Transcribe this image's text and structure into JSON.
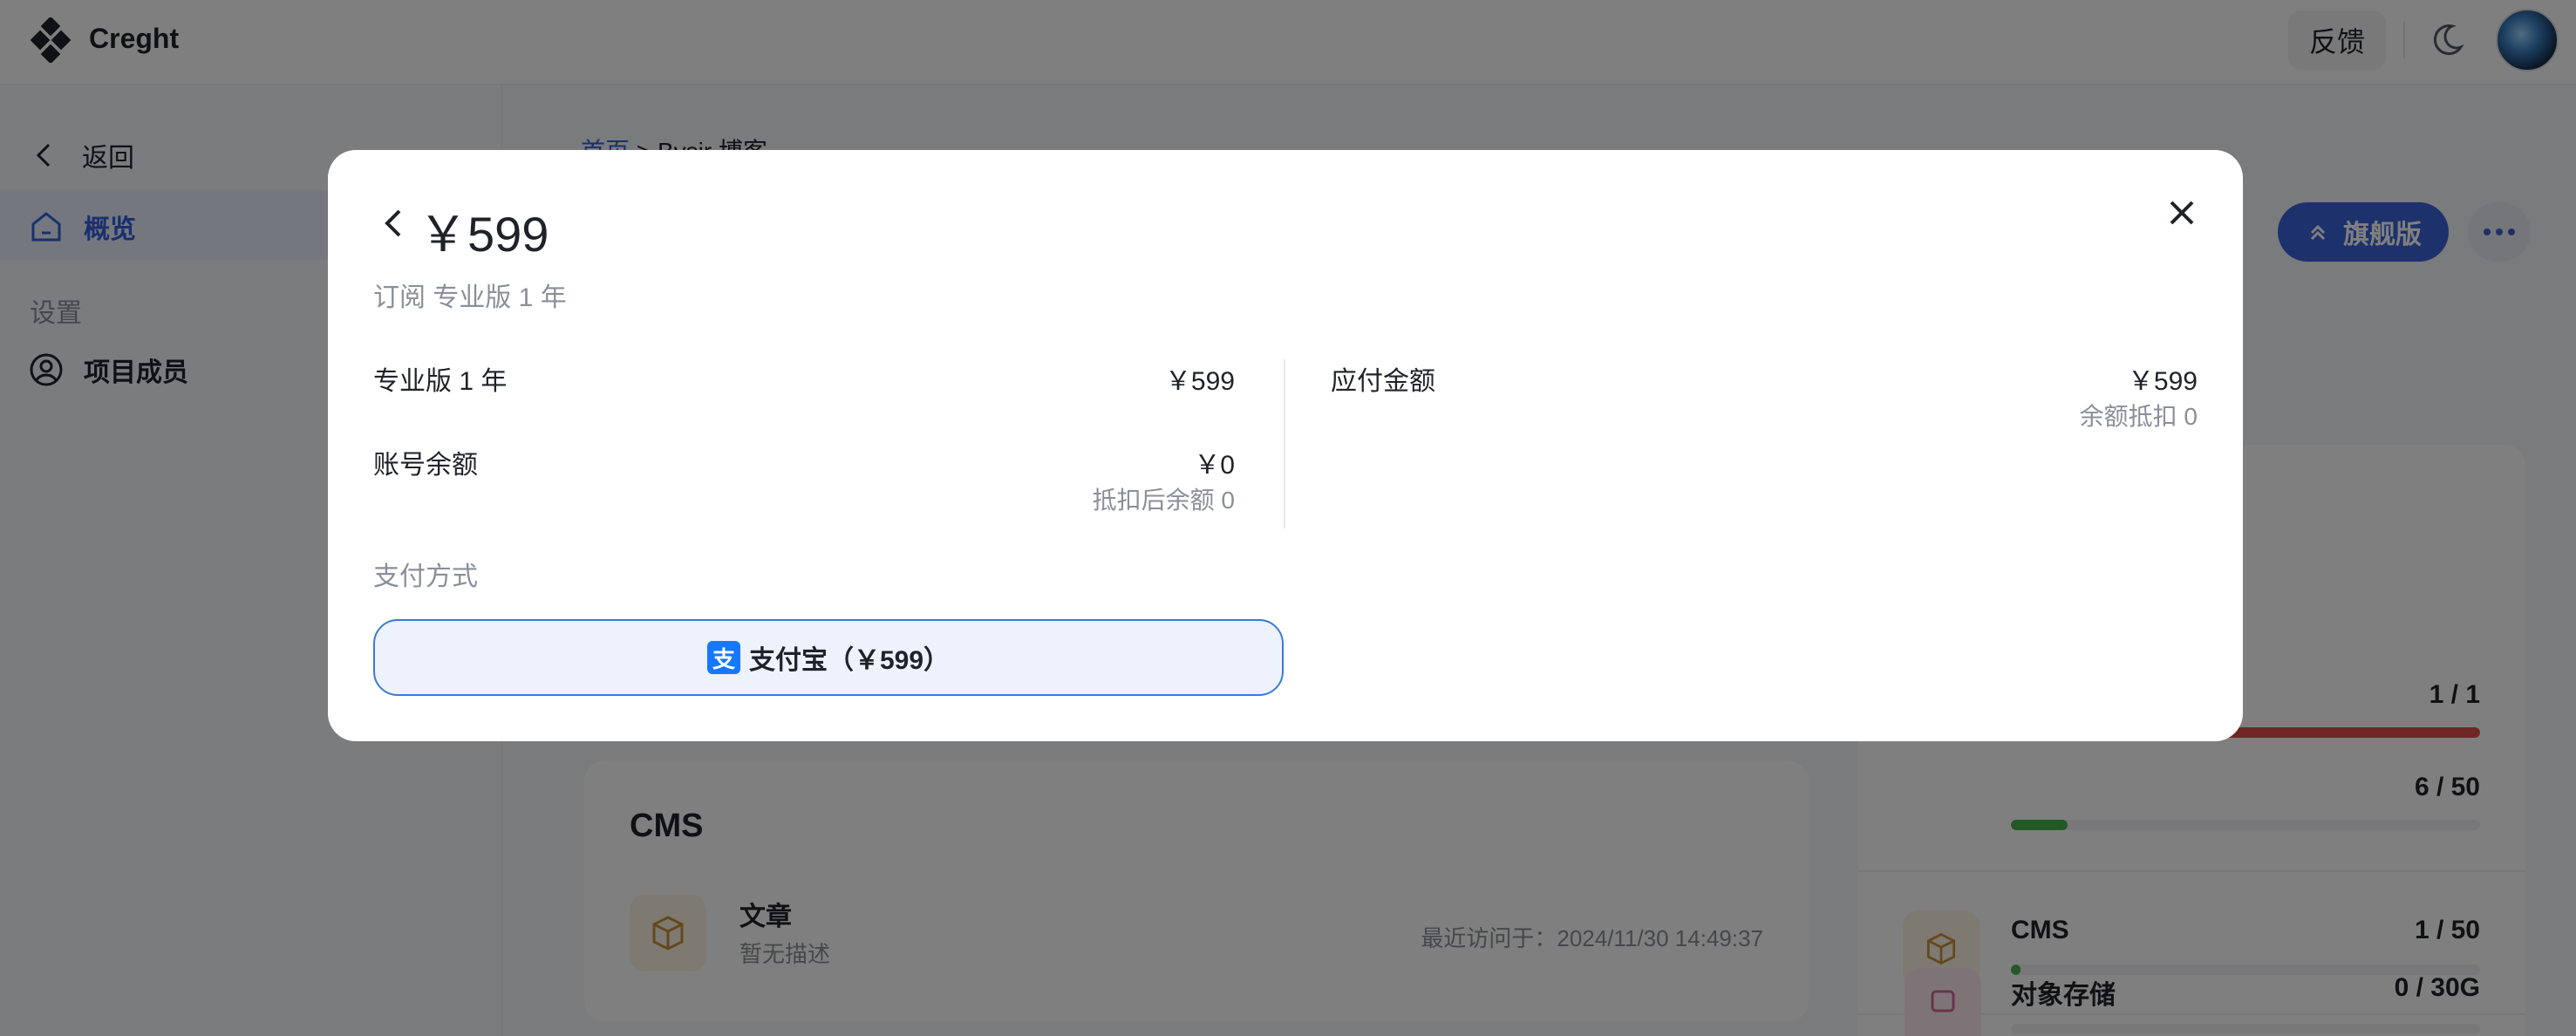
{
  "topbar": {
    "brand": "Creght",
    "feedback_label": "反馈",
    "theme_icon": "moon-icon",
    "avatar_icon": "avatar"
  },
  "sidebar": {
    "back_label": "返回",
    "overview_label": "概览",
    "settings_section": "设置",
    "members_label": "项目成员"
  },
  "main": {
    "breadcrumb_home": "首页",
    "breadcrumb_sep": ">",
    "breadcrumb_current": "Bysir 博客",
    "flagship_label": "旗舰版"
  },
  "cms_card": {
    "title": "CMS",
    "article_title": "文章",
    "article_desc": "暂无描述",
    "last_visit": "最近访问于：2024/11/30 14:49:37"
  },
  "usage": {
    "rows": [
      {
        "name": "",
        "value": "1 / 1",
        "fraction": 1.0,
        "color": "#e04c4c"
      },
      {
        "name": "",
        "value": "6 / 50",
        "fraction": 0.12,
        "color": "#49b14f"
      },
      {
        "name": "CMS",
        "value": "1 / 50",
        "fraction": 0.02,
        "color": "#49b14f"
      },
      {
        "name": "对象存储",
        "value": "0 / 30G",
        "fraction": 0.0,
        "color": "#49b14f"
      }
    ]
  },
  "modal": {
    "price": "￥599",
    "subtitle": "订阅 专业版 1 年",
    "item_label": "专业版 1 年",
    "item_value": "￥599",
    "balance_label": "账号余额",
    "balance_value": "￥0",
    "balance_note": "抵扣后余额 0",
    "due_label": "应付金额",
    "due_value": "￥599",
    "due_note": "余额抵扣 0",
    "pay_method_label": "支付方式",
    "pay_button_label": "支付宝（￥599）",
    "alipay_glyph": "支",
    "accent_color": "#3a7bd5"
  }
}
